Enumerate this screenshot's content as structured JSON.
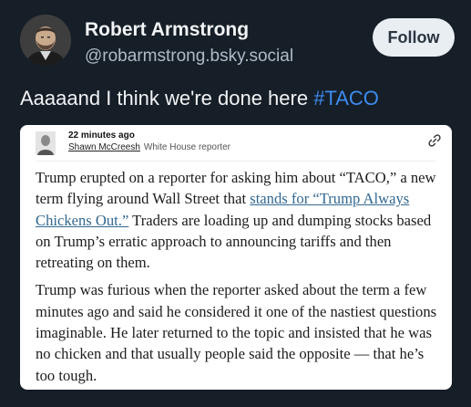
{
  "post": {
    "author": {
      "name": "Robert Armstrong",
      "handle": "@robarmstrong.bsky.social"
    },
    "follow_label": "Follow",
    "text": "Aaaaand I think we're done here ",
    "hashtag": "#TACO"
  },
  "embedded_card": {
    "timestamp": "22 minutes ago",
    "byline_name": "Shawn McCreesh",
    "byline_role": "White House reporter",
    "paragraphs": {
      "p1_before": "Trump erupted on a reporter for asking him about “TACO,” a new term flying around Wall Street that ",
      "p1_link": "stands for “Trump Always Chickens Out.”",
      "p1_after": " Traders are loading up and dumping stocks based on Trump’s erratic approach to announcing tariffs and then retreating on them.",
      "p2": "Trump was furious when the reporter asked about the term a few minutes ago and said he considered it one of the nastiest questions imaginable. He later returned to the topic and insisted that he was no chicken and that usually people said the opposite — that he’s too tough."
    }
  },
  "colors": {
    "background": "#161e27",
    "hashtag": "#3c8cf0",
    "follow_button": "#e9eef3",
    "link": "#326891"
  },
  "icons": {
    "avatar": "portrait-avatar",
    "byline_avatar": "reporter-avatar",
    "link": "link-icon"
  }
}
